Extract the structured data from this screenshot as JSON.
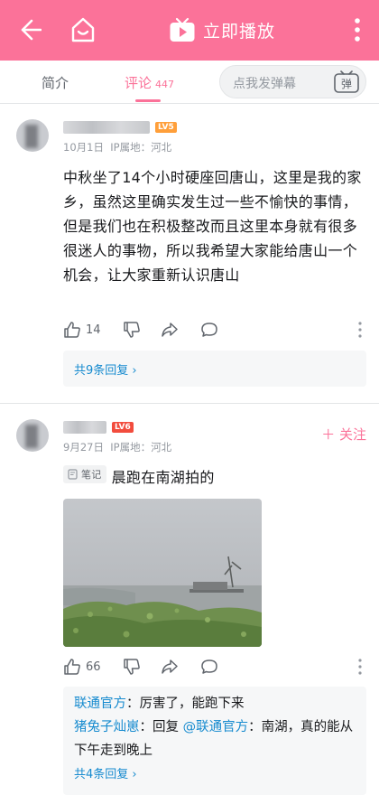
{
  "header": {
    "back_icon": "back-arrow-icon",
    "home_icon": "home-icon",
    "play_icon": "tv-play-icon",
    "play_label": "立即播放",
    "more_icon": "more-vertical-icon",
    "bg_color": "#fb7299"
  },
  "tabs": {
    "intro_label": "简介",
    "comments_label": "评论",
    "comments_count": "447",
    "danmaku_placeholder": "点我发弹幕",
    "danmaku_icon_text": "弹"
  },
  "comments": [
    {
      "level": "LV5",
      "date": "10月1日",
      "ip": "IP属地：河北",
      "text": "中秋坐了14个小时硬座回唐山，这里是我的家乡，虽然这里确实发生过一些不愉快的事情，但是我们也在积极整改而且这里本身就有很多很迷人的事物，所以我希望大家能给唐山一个机会，让大家重新认识唐山",
      "likes": "14",
      "reply_more": "共9条回复 ›"
    },
    {
      "level": "LV6",
      "date": "9月27日",
      "ip": "IP属地：河北",
      "follow_label": "＋ 关注",
      "note_tag": "笔记",
      "text": "晨跑在南湖拍的",
      "likes": "66",
      "replies": [
        {
          "name": "联通官方",
          "sep": "：",
          "text": "厉害了，能跑下来"
        },
        {
          "name": "猪兔子灿崽",
          "sep": "：",
          "prefix": "回复 ",
          "mention": "@联通官方",
          "text": "：南湖，真的能从下午走到晚上"
        }
      ],
      "reply_more": "共4条回复 ›"
    }
  ],
  "colors": {
    "accent": "#fb7299",
    "link": "#178bcf",
    "lv5": "#ff9f3a",
    "lv6": "#f24c3d"
  }
}
